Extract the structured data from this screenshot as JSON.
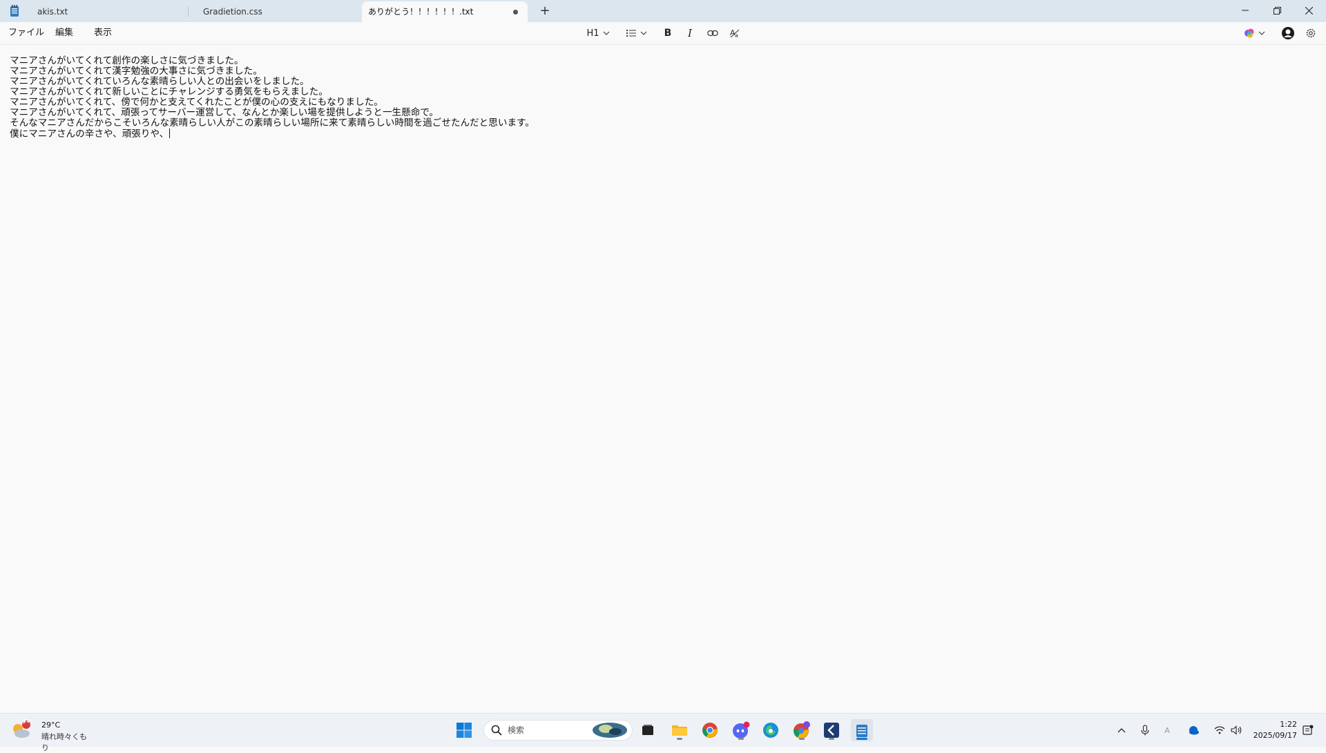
{
  "window": {
    "tabs": [
      {
        "label": "akis.txt",
        "active": false
      },
      {
        "label": "Gradietion.css",
        "active": false
      },
      {
        "label": "ありがとう！！！！！！.txt",
        "active": true,
        "unsaved": true
      }
    ]
  },
  "menu": {
    "file": "ファイル",
    "edit": "編集",
    "view": "表示"
  },
  "toolbar": {
    "heading": "H1",
    "items": [
      "heading",
      "list",
      "bold",
      "italic",
      "link",
      "clear-formatting"
    ]
  },
  "editor": {
    "lines": [
      "マニアさんがいてくれて創作の楽しさに気づきました。",
      "マニアさんがいてくれて漢字勉強の大事さに気づきました。",
      "マニアさんがいてくれていろんな素晴らしい人との出会いをしました。",
      "マニアさんがいてくれて新しいことにチャレンジする勇気をもらえました。",
      "マニアさんがいてくれて、傍で何かと支えてくれたことが僕の心の支えにもなりました。",
      "マニアさんがいてくれて、頑張ってサーバー運営して、なんとか楽しい場を提供しようと一生懸命で。",
      "そんなマニアさんだからこそいろんな素晴らしい人がこの素晴らしい場所に来て素晴らしい時間を過ごせたんだと思います。",
      "僕にマニアさんの辛さや、頑張りや、"
    ]
  },
  "taskbar": {
    "weather": {
      "temp": "29°C",
      "desc": "晴れ時々くもり",
      "badge": "9+"
    },
    "search_placeholder": "検索",
    "clock": {
      "time": "1:22",
      "date": "2025/09/17"
    }
  },
  "colors": {
    "titlebar": "#dce6ee",
    "editor_bg": "#f9f9f9",
    "taskbar": "#eef1f6",
    "windows_blue": "#0078d4"
  }
}
